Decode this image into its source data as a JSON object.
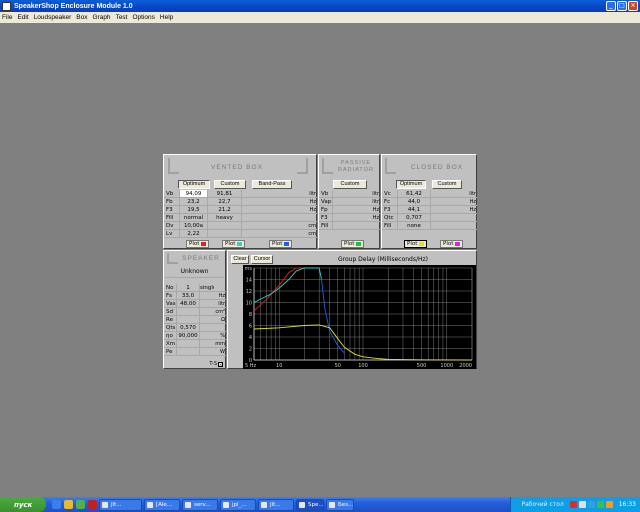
{
  "window": {
    "title": "SpeakerShop Enclosure Module 1.0"
  },
  "menu": [
    "File",
    "Edit",
    "Loudspeaker",
    "Box",
    "Graph",
    "Test",
    "Options",
    "Help"
  ],
  "vented": {
    "title": "VENTED BOX",
    "buttons": [
      "Optimum",
      "Custom",
      "Band-Pass"
    ],
    "rows": [
      {
        "label": "Vb",
        "v1": "94,09",
        "v2": "91,81",
        "v3": "",
        "unit": "litr"
      },
      {
        "label": "Fb",
        "v1": "23,2",
        "v2": "22,7",
        "v3": "",
        "unit": "Hz"
      },
      {
        "label": "F3",
        "v1": "19,5",
        "v2": "21,2",
        "v3": "",
        "unit": "Hz"
      },
      {
        "label": "Fill",
        "v1": "normal",
        "v2": "heavy",
        "v3": "",
        "unit": ""
      },
      {
        "label": "Dv",
        "v1": "10,00a",
        "v2": "",
        "v3": "",
        "unit": "cm"
      },
      {
        "label": "Lv",
        "v1": "2,22",
        "v2": "",
        "v3": "",
        "unit": "cm"
      }
    ],
    "plots": [
      {
        "label": "Plot",
        "color": "#e02020"
      },
      {
        "label": "Plot",
        "color": "#30d0d0"
      },
      {
        "label": "Plot",
        "color": "#2060e0"
      }
    ]
  },
  "passive": {
    "title": "PASSIVE RADIATOR",
    "button": "Custom",
    "rows": [
      {
        "label": "Vb",
        "unit": "litr"
      },
      {
        "label": "Vap",
        "unit": "litr"
      },
      {
        "label": "Fp",
        "unit": "Hz"
      },
      {
        "label": "F3",
        "unit": "Hz"
      },
      {
        "label": "Fill",
        "unit": ""
      }
    ],
    "plot": {
      "label": "Plot",
      "color": "#20c040"
    }
  },
  "closed": {
    "title": "CLOSED BOX",
    "buttons": [
      "Optimum",
      "Custom"
    ],
    "rows": [
      {
        "label": "Vc",
        "v1": "61,42",
        "unit": "litr"
      },
      {
        "label": "Fc",
        "v1": "44,0",
        "unit": "Hz"
      },
      {
        "label": "F3",
        "v1": "44,1",
        "unit": "Hz"
      },
      {
        "label": "Qtc",
        "v1": "0,707",
        "unit": ""
      },
      {
        "label": "Fill",
        "v1": "none",
        "unit": ""
      }
    ],
    "plots": [
      {
        "label": "Plot",
        "color": "#e0e020"
      },
      {
        "label": "Plot",
        "color": "#e020e0"
      }
    ]
  },
  "speaker": {
    "title": "SPEAKER",
    "name": "Unknown",
    "rows": [
      {
        "label": "No",
        "v1": "1",
        "v2": "single",
        "unit": ""
      },
      {
        "label": "Fs",
        "v1": "33,0",
        "unit": "Hz"
      },
      {
        "label": "Vas",
        "v1": "48,00",
        "unit": "litr"
      },
      {
        "label": "Sd",
        "v1": "",
        "unit": "cm²"
      },
      {
        "label": "Re",
        "v1": "",
        "unit": "Ω"
      },
      {
        "label": "Qts",
        "v1": "0,570",
        "unit": ""
      },
      {
        "label": "ηo",
        "v1": "90,000",
        "unit": "%"
      },
      {
        "label": "Xm",
        "v1": "",
        "unit": "mm"
      },
      {
        "label": "Pe",
        "v1": "",
        "unit": "W"
      }
    ],
    "ts_label": "T-S"
  },
  "graph": {
    "buttons": [
      "Clear",
      "Cursor"
    ],
    "title": "Group Delay (Milliseconds/Hz)"
  },
  "chart_data": {
    "type": "line",
    "title": "Group Delay (Milliseconds/Hz)",
    "xlabel": "",
    "ylabel": "",
    "x_scale": "log",
    "xlim": [
      5,
      2000
    ],
    "ylim": [
      0,
      16
    ],
    "x_ticks": [
      "5 Hz",
      "10",
      "50",
      "100",
      "500",
      "1000",
      "2000"
    ],
    "y_ticks": [
      "ms",
      "14",
      "12",
      "10",
      "8",
      "6",
      "4",
      "2",
      "0"
    ],
    "series": [
      {
        "color": "#e02020",
        "x": [
          5,
          7,
          10,
          13,
          16,
          20
        ],
        "y": [
          8.5,
          10.5,
          13,
          15.2,
          16,
          16
        ]
      },
      {
        "color": "#30d0d0",
        "x": [
          5,
          6,
          8,
          10,
          13,
          16,
          20,
          25,
          30,
          32
        ],
        "y": [
          10,
          10.6,
          11.5,
          12.5,
          14,
          15.5,
          16,
          16,
          16,
          14
        ]
      },
      {
        "color": "#2060e0",
        "x": [
          32,
          35,
          40,
          50,
          60
        ],
        "y": [
          14,
          9,
          5,
          2.5,
          1.2
        ]
      },
      {
        "color": "#e0e020",
        "x": [
          5,
          10,
          20,
          30,
          40,
          50,
          60,
          80,
          100,
          150,
          200,
          500,
          2000
        ],
        "y": [
          5.4,
          5.6,
          6,
          6.1,
          5.6,
          3.7,
          2.2,
          1,
          0.55,
          0.25,
          0.13,
          0.03,
          0
        ]
      }
    ]
  },
  "taskbar": {
    "start": "пуск",
    "items": [
      "Jlt...",
      "[Ale...",
      "serv...",
      "jpl_...",
      "Jlt...",
      "Spe...",
      "Без..."
    ],
    "tray_label": "Рабочий стол",
    "clock": "16:33"
  }
}
